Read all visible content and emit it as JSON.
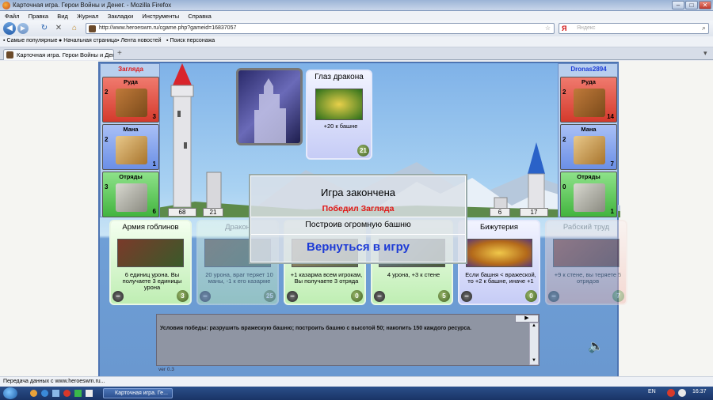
{
  "window": {
    "title": "Карточная игра. Герои Войны и Денег. - Mozilla Firefox",
    "controls": [
      "–",
      "□",
      "✕"
    ]
  },
  "menu": [
    "Файл",
    "Правка",
    "Вид",
    "Журнал",
    "Закладки",
    "Инструменты",
    "Справка"
  ],
  "nav": {
    "url": "http://www.heroeswm.ru/cgame.php?gameid=16837057",
    "search_placeholder": "Яндекс"
  },
  "bookmarks": [
    "Самые популярные",
    "Начальная страница",
    "Лента новостей",
    "Поиск персонажа"
  ],
  "tab": {
    "title": "Карточная игра. Герои Войны и Ден...",
    "new_tab": "+"
  },
  "game": {
    "left_player": {
      "name": "Загляда",
      "name_color": "#e01818",
      "resources": [
        {
          "label": "Руда",
          "gen": "2",
          "amount": "3"
        },
        {
          "label": "Мана",
          "gen": "2",
          "amount": "1"
        },
        {
          "label": "Отряды",
          "gen": "3",
          "amount": "6"
        }
      ],
      "tower": "68",
      "wall": "21"
    },
    "right_player": {
      "name": "Dronas2894",
      "name_color": "#1d3bd6",
      "resources": [
        {
          "label": "Руда",
          "gen": "2",
          "amount": "14"
        },
        {
          "label": "Мана",
          "gen": "2",
          "amount": "7"
        },
        {
          "label": "Отряды",
          "gen": "0",
          "amount": "1"
        }
      ],
      "tower": "17",
      "wall": "6"
    },
    "played_card": {
      "name": "Глаз дракона",
      "desc": "+20 к башне",
      "cost": "21"
    },
    "hand": [
      {
        "name": "Армия гоблинов",
        "desc": "6 единиц урона. Вы получаете 3 единицы урона",
        "cost": "3",
        "style": "green",
        "dim": false
      },
      {
        "name": "Дракон",
        "desc": "20 урона, враг теряет 10 маны, -1 к его казарме",
        "cost": "25",
        "style": "green",
        "dim": true
      },
      {
        "name": "",
        "desc": "+1 казарма всем игрокам, Вы получаете 3 отряда",
        "cost": "0",
        "style": "green",
        "dim": false
      },
      {
        "name": "",
        "desc": "4 урона, +3 к стене",
        "cost": "5",
        "style": "green",
        "dim": false
      },
      {
        "name": "Бижутерия",
        "desc": "Если башня < вражеской, то +2 к башне, иначе +1",
        "cost": "0",
        "style": "blue",
        "dim": false
      },
      {
        "name": "Рабский труд",
        "desc": "+9 к стене, вы теряете 5 отрядов",
        "cost": "7",
        "style": "red",
        "dim": true
      }
    ],
    "dialog": {
      "header": "Игра закончена",
      "winner": "Победил Загляда",
      "reason": "Построив огромную башню",
      "back": "Вернуться в игру"
    },
    "log": "Условия победы: разрушить вражескую башню; построить башню с высотой 50; накопить 150 каждого ресурса.",
    "version": "ver 0.3"
  },
  "status": "Передача данных с www.heroeswm.ru...",
  "taskbar": {
    "item": "Карточная игра. Ге...",
    "lang": "EN",
    "time": "16:37"
  }
}
